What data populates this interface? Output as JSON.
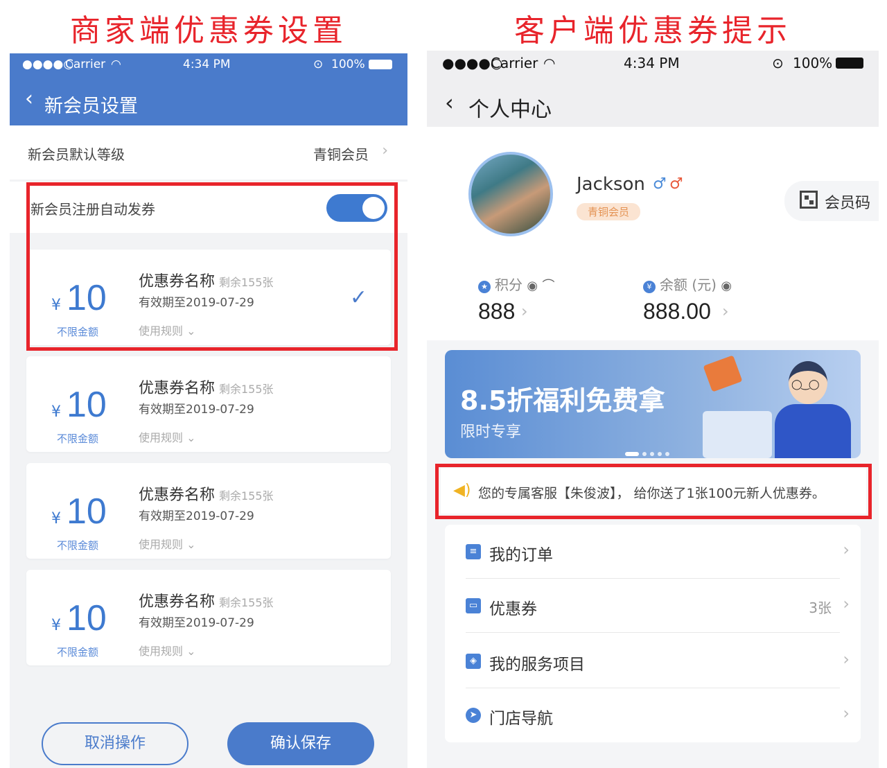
{
  "captions": {
    "left": "商家端优惠券设置",
    "right": "客户端优惠券提示"
  },
  "merchant": {
    "status": {
      "signal": "●●●●○",
      "carrier": "Carrier",
      "time": "4:34 PM",
      "battery": "100%"
    },
    "nav": {
      "back_icon": "chevron-left",
      "title": "新会员设置"
    },
    "default_level": {
      "label": "新会员默认等级",
      "value": "青铜会员"
    },
    "auto_issue": {
      "label": "新会员注册自动发券",
      "enabled": true
    },
    "coupons": [
      {
        "currency": "¥",
        "amount": "10",
        "limit": "不限金额",
        "name": "优惠券名称",
        "remaining": "剩余155张",
        "expiry": "有效期至2019-07-29",
        "rules": "使用规则",
        "selected": true
      },
      {
        "currency": "¥",
        "amount": "10",
        "limit": "不限金额",
        "name": "优惠券名称",
        "remaining": "剩余155张",
        "expiry": "有效期至2019-07-29",
        "rules": "使用规则",
        "selected": false
      },
      {
        "currency": "¥",
        "amount": "10",
        "limit": "不限金额",
        "name": "优惠券名称",
        "remaining": "剩余155张",
        "expiry": "有效期至2019-07-29",
        "rules": "使用规则",
        "selected": false
      },
      {
        "currency": "¥",
        "amount": "10",
        "limit": "不限金额",
        "name": "优惠券名称",
        "remaining": "剩余155张",
        "expiry": "有效期至2019-07-29",
        "rules": "使用规则",
        "selected": false
      }
    ],
    "buttons": {
      "cancel": "取消操作",
      "save": "确认保存"
    },
    "colors": {
      "primary": "#4a7bcb",
      "highlight": "#e8242b"
    }
  },
  "customer": {
    "status": {
      "signal": "●●●●○",
      "carrier": "Carrier",
      "time": "4:34 PM",
      "battery": "100%"
    },
    "nav": {
      "back_icon": "chevron-left",
      "title": "个人中心"
    },
    "profile": {
      "username": "Jackson",
      "gender_icons": [
        "♂",
        "♂"
      ],
      "level_badge": "青铜会员",
      "member_code": "会员码"
    },
    "stats": {
      "points": {
        "label": "积分",
        "value": "888"
      },
      "balance": {
        "label": "余额 (元)",
        "value": "888.00"
      }
    },
    "banner": {
      "headline": "8.5折福利免费拿",
      "subtitle": "限时专享",
      "page_count": 5,
      "active_page": 1
    },
    "notice": {
      "text": "您的专属客服【朱俊波】， 给你送了1张100元新人优惠券。"
    },
    "menu": [
      {
        "label": "我的订单",
        "icon": "clipboard-icon",
        "count": ""
      },
      {
        "label": "优惠券",
        "icon": "ticket-icon",
        "count": "3张"
      },
      {
        "label": "我的服务项目",
        "icon": "layers-icon",
        "count": ""
      },
      {
        "label": "门店导航",
        "icon": "compass-icon",
        "count": ""
      }
    ]
  }
}
